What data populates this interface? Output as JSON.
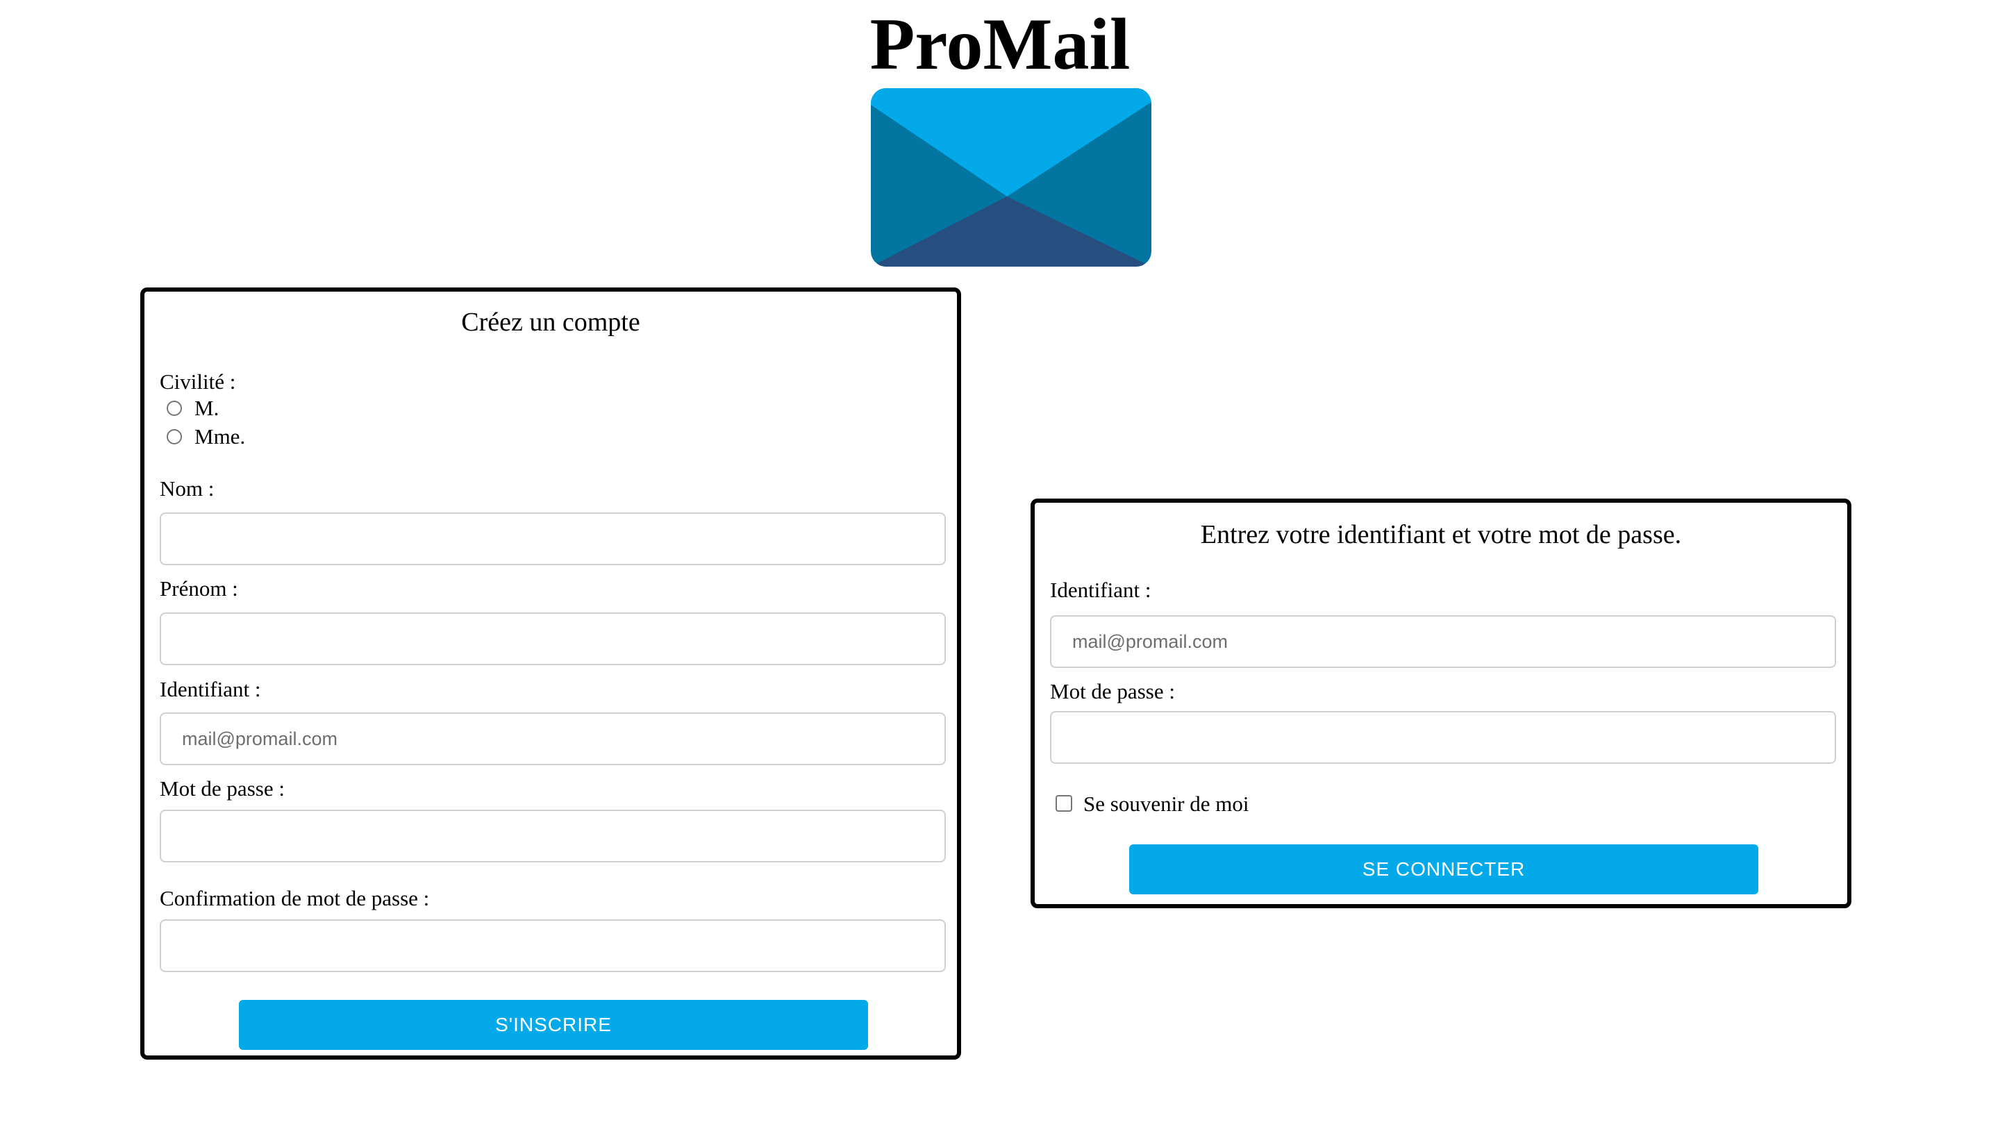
{
  "app": {
    "title": "ProMail",
    "logo_icon": "envelope-icon"
  },
  "colors": {
    "accent": "#03A9E8",
    "envelope_top": "#03A9E8",
    "envelope_sides": "#0275A1",
    "envelope_bottom": "#264F7F"
  },
  "signup": {
    "title": "Créez un compte",
    "civility_label": "Civilité :",
    "civility_options": [
      "M.",
      "Mme."
    ],
    "last_name_label": "Nom :",
    "last_name_value": "",
    "first_name_label": "Prénom :",
    "first_name_value": "",
    "identifier_label": "Identifiant :",
    "identifier_placeholder": "mail@promail.com",
    "password_label": "Mot de passe :",
    "password_value": "",
    "password_confirm_label": "Confirmation de mot de passe :",
    "password_confirm_value": "",
    "submit_label": "S'INSCRIRE"
  },
  "login": {
    "title": "Entrez votre identifiant et votre mot de passe.",
    "identifier_label": "Identifiant :",
    "identifier_placeholder": "mail@promail.com",
    "password_label": "Mot de passe :",
    "password_value": "",
    "remember_label": "Se souvenir de moi",
    "remember_checked": false,
    "submit_label": "SE CONNECTER"
  }
}
